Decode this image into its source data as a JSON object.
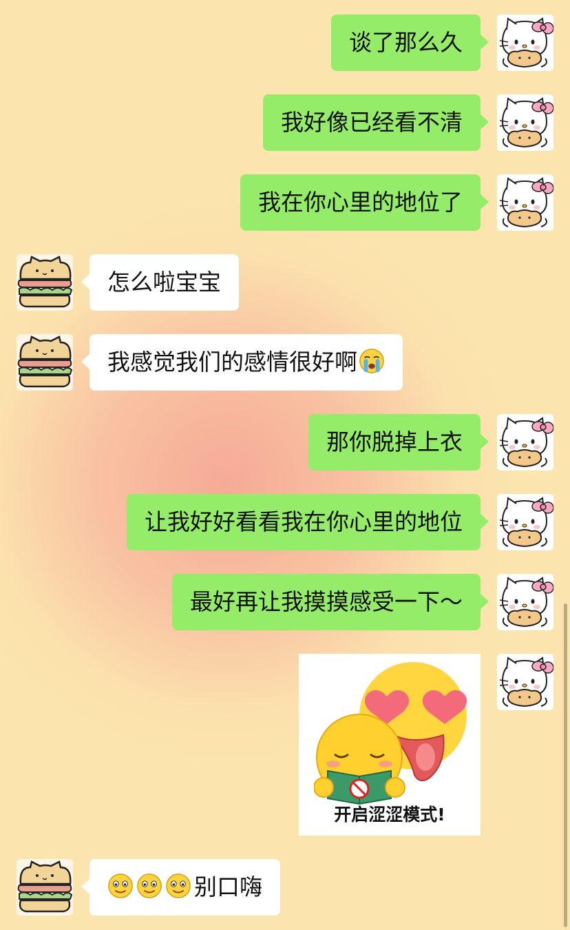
{
  "messages": [
    {
      "sender": "me",
      "text": "谈了那么久"
    },
    {
      "sender": "me",
      "text": "我好像已经看不清"
    },
    {
      "sender": "me",
      "text": "我在你心里的地位了"
    },
    {
      "sender": "them",
      "text": "怎么啦宝宝"
    },
    {
      "sender": "them",
      "text": "我感觉我们的感情很好啊",
      "trailing_emoji": "crying-emoji"
    },
    {
      "sender": "me",
      "text": "那你脱掉上衣"
    },
    {
      "sender": "me",
      "text": "让我好好看看我在你心里的地位"
    },
    {
      "sender": "me",
      "text": "最好再让我摸摸感受一下～"
    },
    {
      "sender": "me",
      "type": "sticker",
      "caption": "开启涩涩模式!",
      "badge": "18"
    },
    {
      "sender": "them",
      "leading_emojis": [
        "smile-emoji",
        "smile-emoji",
        "smile-emoji"
      ],
      "text": "别口嗨"
    }
  ],
  "avatars": {
    "me": "hello-kitty-avatar-icon",
    "them": "sandwich-avatar-icon"
  },
  "colors": {
    "outgoing_bubble": "#95ec69",
    "incoming_bubble": "#ffffff",
    "background": "#fbe4ae"
  }
}
